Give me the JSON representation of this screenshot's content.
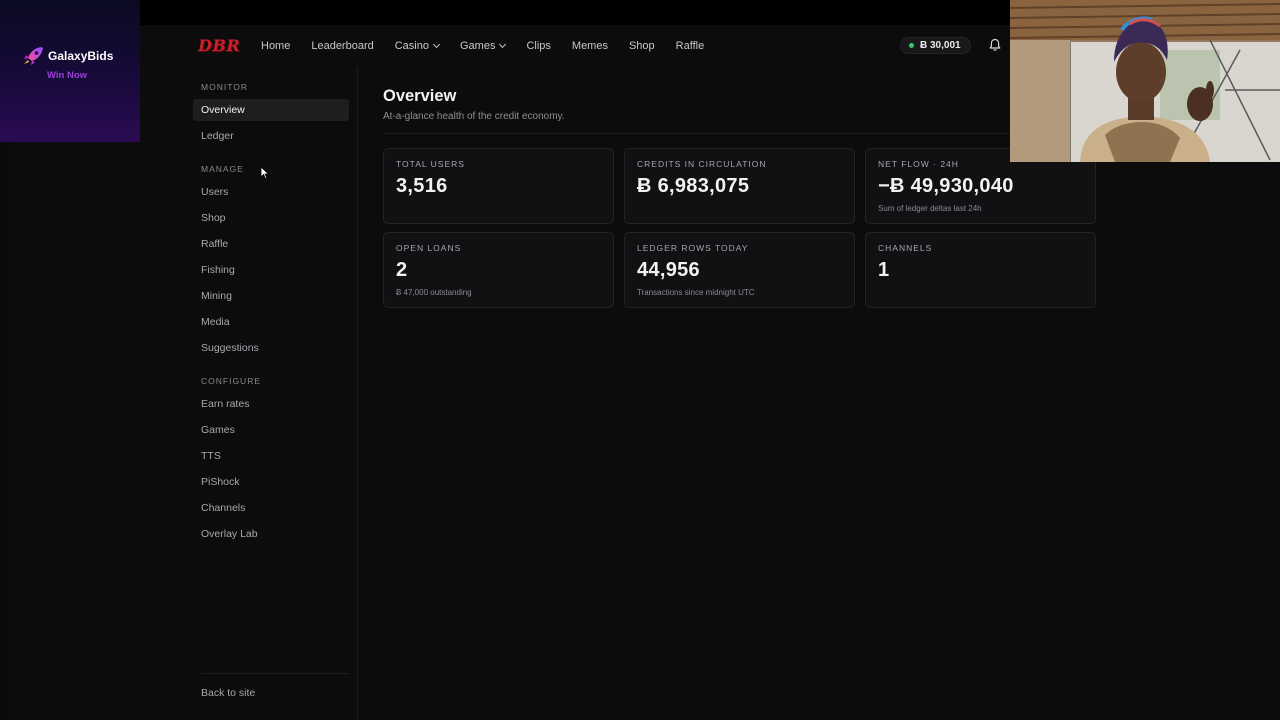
{
  "ad": {
    "brand": "GalaxyBids",
    "cta": "Win Now",
    "logo_icon": "rocket-icon"
  },
  "header": {
    "logo": "DBR",
    "nav": [
      {
        "label": "Home",
        "dropdown": false
      },
      {
        "label": "Leaderboard",
        "dropdown": false
      },
      {
        "label": "Casino",
        "dropdown": true
      },
      {
        "label": "Games",
        "dropdown": true
      },
      {
        "label": "Clips",
        "dropdown": false
      },
      {
        "label": "Memes",
        "dropdown": false
      },
      {
        "label": "Shop",
        "dropdown": false
      },
      {
        "label": "Raffle",
        "dropdown": false
      }
    ],
    "balance": "Ƀ 30,001",
    "balance_status_color": "#2ecc71",
    "bell_icon": "bell-icon"
  },
  "sidebar": {
    "monitor_title": "MONITOR",
    "monitor_items": [
      "Overview",
      "Ledger"
    ],
    "manage_title": "MANAGE",
    "manage_items": [
      "Users",
      "Shop",
      "Raffle",
      "Fishing",
      "Mining",
      "Media",
      "Suggestions"
    ],
    "configure_title": "CONFIGURE",
    "configure_items": [
      "Earn rates",
      "Games",
      "TTS",
      "PiShock",
      "Channels",
      "Overlay Lab"
    ],
    "back_label": "Back to site"
  },
  "main": {
    "title": "Overview",
    "subtitle": "At-a-glance health of the credit economy.",
    "cards": [
      {
        "label": "TOTAL USERS",
        "value": "3,516",
        "note": ""
      },
      {
        "label": "CREDITS IN CIRCULATION",
        "value": "Ƀ 6,983,075",
        "note": ""
      },
      {
        "label": "NET FLOW · 24H",
        "value": "−Ƀ 49,930,040",
        "note": "Sum of ledger deltas last 24h"
      },
      {
        "label": "OPEN LOANS",
        "value": "2",
        "note": "Ƀ 47,000 outstanding"
      },
      {
        "label": "LEDGER ROWS TODAY",
        "value": "44,956",
        "note": "Transactions since midnight UTC"
      },
      {
        "label": "CHANNELS",
        "value": "1",
        "note": ""
      }
    ]
  },
  "colors": {
    "accent_logo": "#c8202c",
    "ad_cta": "#9b3fd6"
  }
}
